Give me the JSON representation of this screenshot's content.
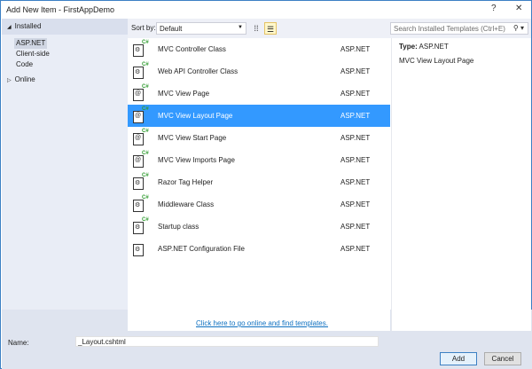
{
  "window": {
    "title": "Add New Item - FirstAppDemo",
    "help": "?",
    "close": "✕"
  },
  "sidebar": {
    "installed": "Installed",
    "items": [
      "ASP.NET",
      "Client-side",
      "Code"
    ],
    "online": "Online"
  },
  "toolbar": {
    "sort_label": "Sort by:",
    "sort_value": "Default",
    "search_placeholder": "Search Installed Templates (Ctrl+E)"
  },
  "templates": [
    {
      "name": "MVC Controller Class",
      "type": "ASP.NET",
      "icon": "controller"
    },
    {
      "name": "Web API Controller Class",
      "type": "ASP.NET",
      "icon": "controller"
    },
    {
      "name": "MVC View Page",
      "type": "ASP.NET",
      "icon": "view"
    },
    {
      "name": "MVC View Layout Page",
      "type": "ASP.NET",
      "icon": "view",
      "selected": true
    },
    {
      "name": "MVC View Start Page",
      "type": "ASP.NET",
      "icon": "view"
    },
    {
      "name": "MVC View Imports Page",
      "type": "ASP.NET",
      "icon": "view"
    },
    {
      "name": "Razor Tag Helper",
      "type": "ASP.NET",
      "icon": "controller"
    },
    {
      "name": "Middleware Class",
      "type": "ASP.NET",
      "icon": "controller"
    },
    {
      "name": "Startup class",
      "type": "ASP.NET",
      "icon": "controller"
    },
    {
      "name": "ASP.NET Configuration File",
      "type": "ASP.NET",
      "icon": "config"
    }
  ],
  "online_link": "Click here to go online and find templates.",
  "details": {
    "type_label": "Type:",
    "type_value": "ASP.NET",
    "description": "MVC View Layout Page"
  },
  "footer": {
    "name_label": "Name:",
    "name_value": "_Layout.cshtml",
    "add": "Add",
    "cancel": "Cancel"
  },
  "colors": {
    "selection": "#3399ff",
    "border": "#3c80c4"
  }
}
